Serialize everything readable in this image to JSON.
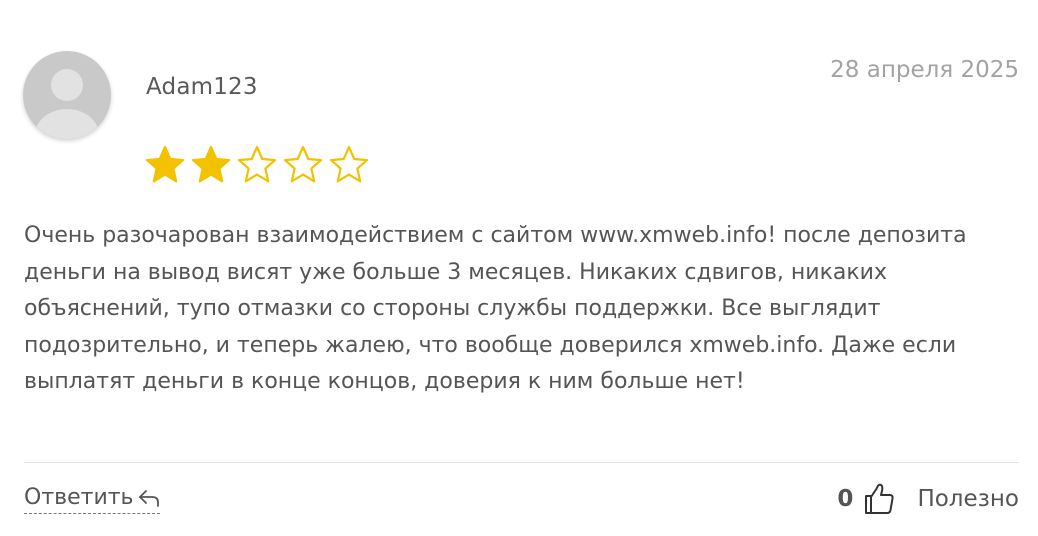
{
  "review": {
    "author": "Adam123",
    "date": "28 апреля 2025",
    "rating": 2,
    "rating_max": 5,
    "text": "Очень разочарован взаимодействием с сайтом www.xmweb.info! после депозита деньги на вывод висят уже больше 3 месяцев. Никаких сдвигов, никаких объяснений, тупо отмазки со стороны службы поддержки. Все выглядит подозрительно, и теперь жалею, что вообще доверился xmweb.info. Даже если выплатят деньги в конце концов, доверия к ним больше нет!"
  },
  "actions": {
    "reply_label": "Ответить",
    "useful_count": "0",
    "useful_label": "Полезно"
  },
  "colors": {
    "star": "#f2c200",
    "avatar_bg": "#c9c9c9",
    "text": "#555555",
    "date": "#a3a3a3"
  },
  "icons": {
    "avatar": "user-silhouette",
    "star": "star",
    "reply": "reply-arrow",
    "useful": "thumbs-up"
  }
}
